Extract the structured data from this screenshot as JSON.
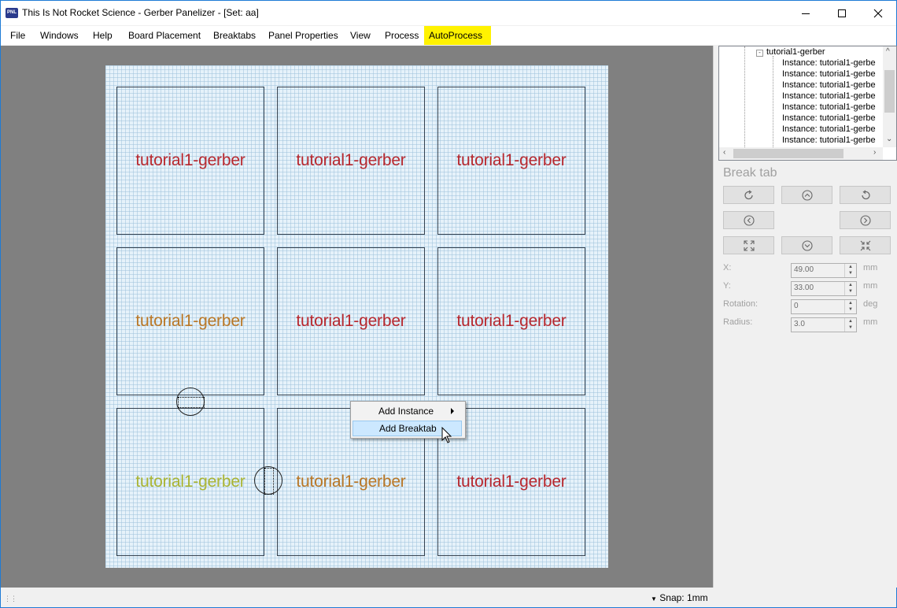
{
  "window": {
    "icon_text": "PNL",
    "title": "This Is Not Rocket Science - Gerber Panelizer - [Set: aa]"
  },
  "menu": {
    "items": [
      "File",
      "Windows",
      "Help",
      "Board Placement",
      "Breaktabs",
      "Panel Properties",
      "View",
      "Process",
      "AutoProcess"
    ],
    "highlight_color": "#fff200"
  },
  "boards": [
    {
      "label": "tutorial1-gerber",
      "color": "#b8282e"
    },
    {
      "label": "tutorial1-gerber",
      "color": "#b8282e"
    },
    {
      "label": "tutorial1-gerber",
      "color": "#b8282e"
    },
    {
      "label": "tutorial1-gerber",
      "color": "#b97726"
    },
    {
      "label": "tutorial1-gerber",
      "color": "#b8282e"
    },
    {
      "label": "tutorial1-gerber",
      "color": "#b8282e"
    },
    {
      "label": "tutorial1-gerber",
      "color": "#aab433"
    },
    {
      "label": "tutorial1-gerber",
      "color": "#b97726"
    },
    {
      "label": "tutorial1-gerber",
      "color": "#b8282e"
    }
  ],
  "context_menu": {
    "items": [
      {
        "label": "Add Instance",
        "has_submenu": true
      },
      {
        "label": "Add Breaktab",
        "selected": true
      }
    ]
  },
  "tree": {
    "root": "tutorial1-gerber",
    "expander": "-",
    "items": [
      "Instance: tutorial1-gerbe",
      "Instance: tutorial1-gerbe",
      "Instance: tutorial1-gerbe",
      "Instance: tutorial1-gerbe",
      "Instance: tutorial1-gerbe",
      "Instance: tutorial1-gerbe",
      "Instance: tutorial1-gerbe",
      "Instance: tutorial1-gerbe"
    ]
  },
  "breaktab_panel": {
    "title": "Break tab",
    "buttons": [
      "rotate-cw-icon",
      "move-up-icon",
      "rotate-ccw-icon",
      "move-left-icon",
      "move-right-icon",
      "expand-icon",
      "move-down-icon",
      "shrink-icon"
    ],
    "fields": [
      {
        "label": "X:",
        "value": "49.00",
        "unit": "mm"
      },
      {
        "label": "Y:",
        "value": "33.00",
        "unit": "mm"
      },
      {
        "label": "Rotation:",
        "value": "0",
        "unit": "deg"
      },
      {
        "label": "Radius:",
        "value": "3.0",
        "unit": "mm"
      }
    ]
  },
  "status": {
    "snap": "Snap: 1mm"
  }
}
